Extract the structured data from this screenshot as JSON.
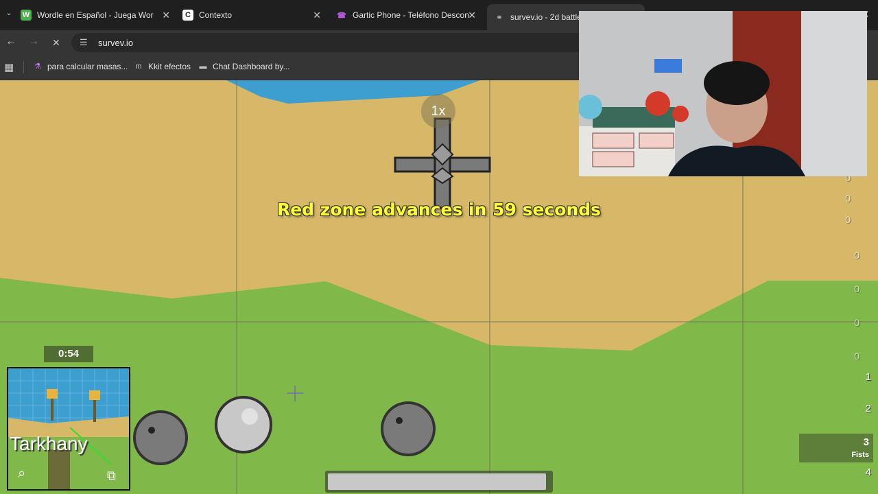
{
  "browser": {
    "tabs": [
      {
        "title": "Wordle en Español - Juega Wor",
        "icon_letter": "W",
        "icon_color": "#4caf50"
      },
      {
        "title": "Contexto",
        "icon_letter": "C",
        "icon_color": "#ffffff"
      },
      {
        "title": "Gartic Phone - Teléfono Descon",
        "icon_letter": "☎",
        "icon_color": "#b05ad8"
      },
      {
        "title": "survev.io - 2d battle r",
        "icon_letter": "⚭",
        "icon_color": "#9aa0a6"
      }
    ],
    "url": "survev.io",
    "bookmarks": [
      {
        "label": "para calcular masas...",
        "icon": "flask-icon"
      },
      {
        "label": "Kkit efectos",
        "icon": "m-icon"
      },
      {
        "label": "Chat Dashboard by...",
        "icon": "dashboard-icon"
      }
    ]
  },
  "game": {
    "zoom_label": "1x",
    "zone_message": "Red zone advances in 59 seconds",
    "timer": "0:54",
    "minimap_label": "Tarkhany",
    "weapon_slots": [
      "1",
      "2",
      "3",
      "4"
    ],
    "equipped_weapon": {
      "slot": "3",
      "name": "Fists"
    },
    "ammo_counts": [
      "0",
      "0",
      "0",
      "0",
      "0",
      "0",
      "0"
    ],
    "health_fraction": 0.98,
    "colors": {
      "sand": "#d6b868",
      "grass": "#80b84a",
      "water": "#3d9fd0",
      "zone_text": "#ffff33"
    }
  }
}
